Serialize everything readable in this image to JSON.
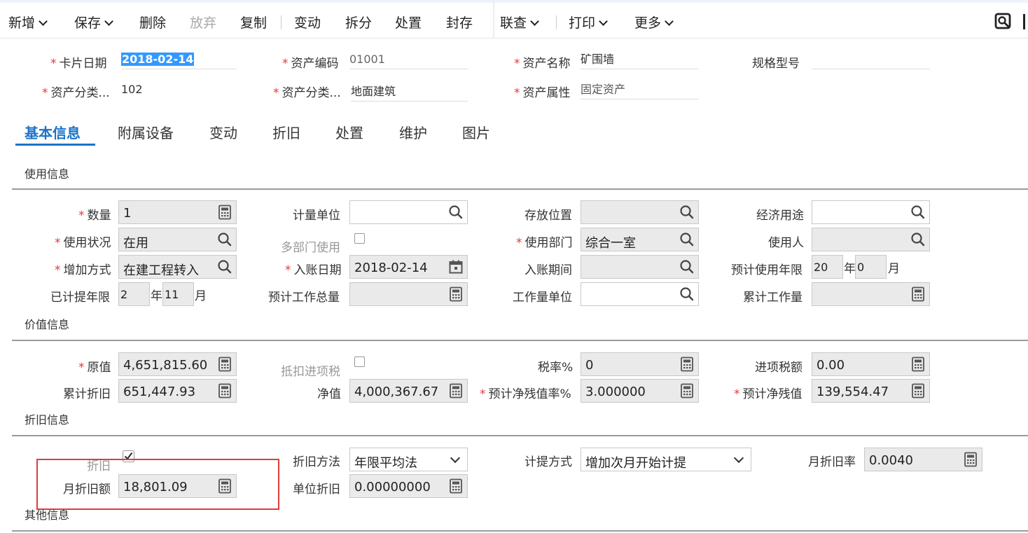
{
  "toolbar": {
    "items": [
      {
        "label": "新增",
        "dropdown": true
      },
      {
        "label": "保存",
        "dropdown": true
      },
      {
        "label": "删除",
        "dropdown": false
      },
      {
        "label": "放弃",
        "dropdown": false,
        "disabled": true
      },
      {
        "label": "复制",
        "dropdown": false
      },
      {
        "label": "变动",
        "dropdown": false
      },
      {
        "label": "拆分",
        "dropdown": false
      },
      {
        "label": "处置",
        "dropdown": false
      },
      {
        "label": "封存",
        "dropdown": false
      },
      {
        "label": "联查",
        "dropdown": true
      },
      {
        "label": "打印",
        "dropdown": true
      },
      {
        "label": "更多",
        "dropdown": true
      }
    ]
  },
  "header": {
    "card_date_label": "卡片日期",
    "card_date": "2018-02-14",
    "asset_code_label": "资产编码",
    "asset_code": "01001",
    "asset_name_label": "资产名称",
    "asset_name": "矿围墙",
    "spec_label": "规格型号",
    "spec": "",
    "category_code_label": "资产分类...",
    "category_code": "102",
    "category_name_label": "资产分类...",
    "category_name": "地面建筑",
    "asset_attr_label": "资产属性",
    "asset_attr": "固定资产"
  },
  "tabs": [
    "基本信息",
    "附属设备",
    "变动",
    "折旧",
    "处置",
    "维护",
    "图片"
  ],
  "usage": {
    "title": "使用信息",
    "qty_label": "数量",
    "qty": "1",
    "unit_label": "计量单位",
    "unit": "",
    "location_label": "存放位置",
    "location": "",
    "purpose_label": "经济用途",
    "purpose": "",
    "status_label": "使用状况",
    "status": "在用",
    "multi_dept_label": "多部门使用",
    "dept_label": "使用部门",
    "dept": "综合一室",
    "user_label": "使用人",
    "user": "",
    "add_method_label": "增加方式",
    "add_method": "在建工程转入",
    "entry_date_label": "入账日期",
    "entry_date": "2018-02-14",
    "entry_period_label": "入账期间",
    "entry_period": "",
    "life_label": "预计使用年限",
    "life_years": "20",
    "life_months": "0",
    "accrued_label": "已计提年限",
    "accrued_years": "2",
    "accrued_months": "11",
    "total_work_label": "预计工作总量",
    "total_work": "",
    "work_unit_label": "工作量单位",
    "work_unit": "",
    "cum_work_label": "累计工作量",
    "cum_work": "",
    "year_unit": "年",
    "month_unit": "月"
  },
  "value": {
    "title": "价值信息",
    "orig_label": "原值",
    "orig": "4,651,815.60",
    "deduct_label": "抵扣进项税",
    "tax_rate_label": "税率%",
    "tax_rate": "0",
    "input_tax_label": "进项税额",
    "input_tax": "0.00",
    "accum_label": "累计折旧",
    "accum": "651,447.93",
    "net_label": "净值",
    "net": "4,000,367.67",
    "residual_rate_label": "预计净残值率%",
    "residual_rate": "3.000000",
    "residual_label": "预计净残值",
    "residual": "139,554.47"
  },
  "depreciation": {
    "title": "折旧信息",
    "dep_label": "折旧",
    "dep_checked": true,
    "method_label": "折旧方法",
    "method": "年限平均法",
    "accrual_label": "计提方式",
    "accrual": "增加次月开始计提",
    "monthly_rate_label": "月折旧率",
    "monthly_rate": "0.0040",
    "monthly_amount_label": "月折旧额",
    "monthly_amount": "18,801.09",
    "unit_dep_label": "单位折旧",
    "unit_dep": "0.00000000"
  },
  "other": {
    "title": "其他信息"
  }
}
